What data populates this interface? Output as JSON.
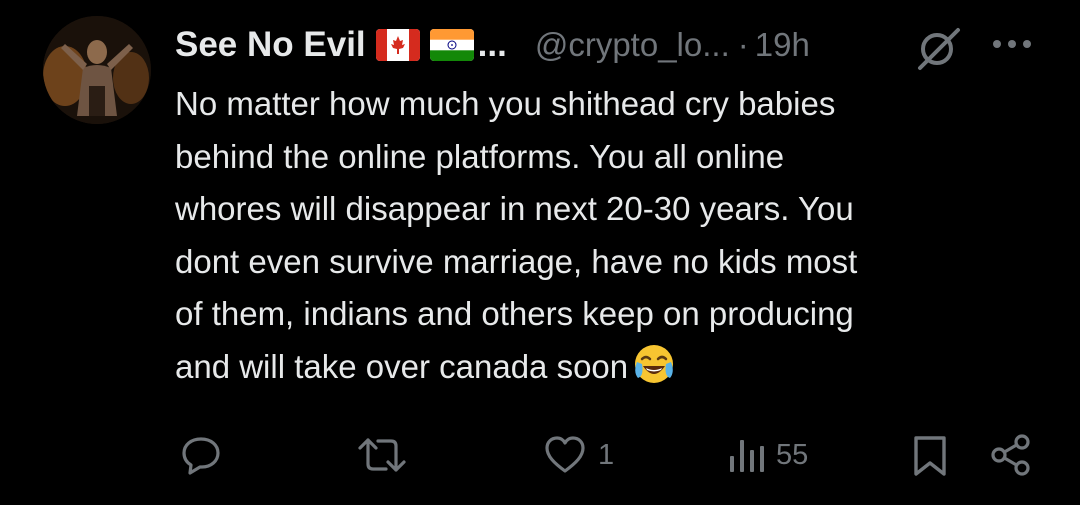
{
  "tweet": {
    "display_name": "See No Evil",
    "flags": [
      "canada-flag-icon",
      "india-flag-icon"
    ],
    "name_ellipsis": "...",
    "handle": "@crypto_lo...",
    "separator": "·",
    "time": "19h",
    "text": "No matter how much you shithead cry babies\nbehind the online platforms. You all online\nwhores will disappear in next 20-30 years. You\ndont even survive marriage, have no kids most\nof them, indians and others keep on producing\nand will take over canada soon",
    "emoji": "face-with-tears-of-joy-icon"
  },
  "actions": {
    "reply_icon": "reply-icon",
    "retweet_icon": "retweet-icon",
    "like_icon": "heart-icon",
    "like_count": "1",
    "views_icon": "views-icon",
    "views_count": "55",
    "bookmark_icon": "bookmark-icon",
    "share_icon": "share-icon"
  },
  "colors": {
    "background": "#000000",
    "text_primary": "#e7e9ea",
    "text_secondary": "#71767b"
  }
}
